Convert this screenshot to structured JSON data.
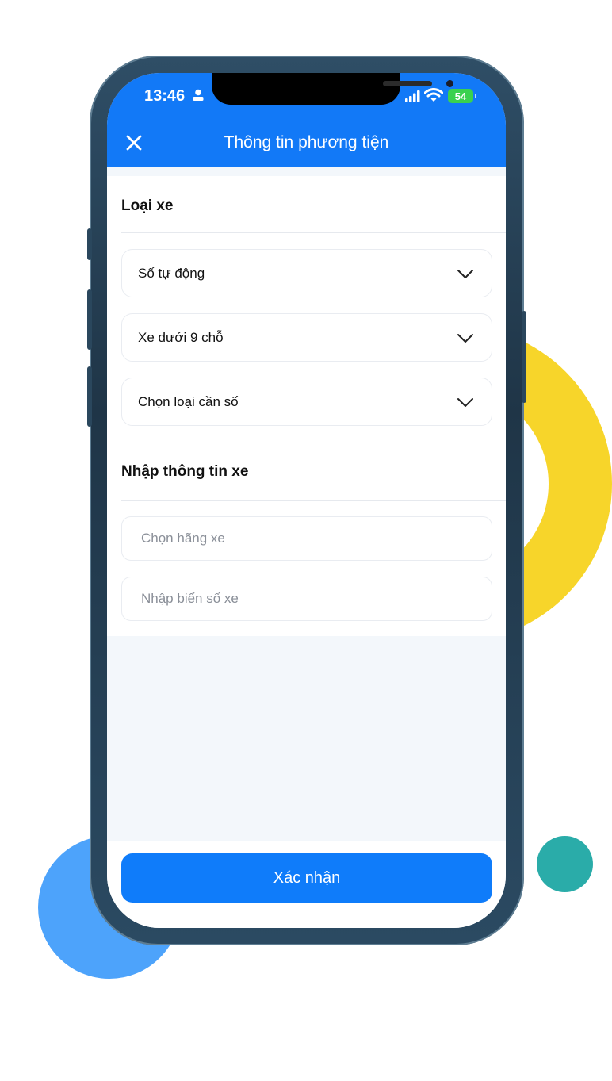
{
  "status_bar": {
    "time": "13:46",
    "battery": "54"
  },
  "header": {
    "title": "Thông tin phương tiện"
  },
  "vehicle_type_section": {
    "title": "Loại xe",
    "selects": [
      {
        "label": "Số tự động"
      },
      {
        "label": "Xe dưới 9 chỗ"
      },
      {
        "label": "Chọn loại cần số"
      }
    ]
  },
  "vehicle_info_section": {
    "title": "Nhập thông tin xe",
    "brand_placeholder": "Chọn hãng xe",
    "plate_placeholder": "Nhập biển số xe"
  },
  "footer": {
    "confirm_label": "Xác nhận"
  },
  "colors": {
    "primary": "#1279f7",
    "confirm_button": "#0f7cfa",
    "deco_yellow": "#f7d52a",
    "deco_blue": "#4da3fb",
    "deco_teal": "#2aaca9"
  }
}
